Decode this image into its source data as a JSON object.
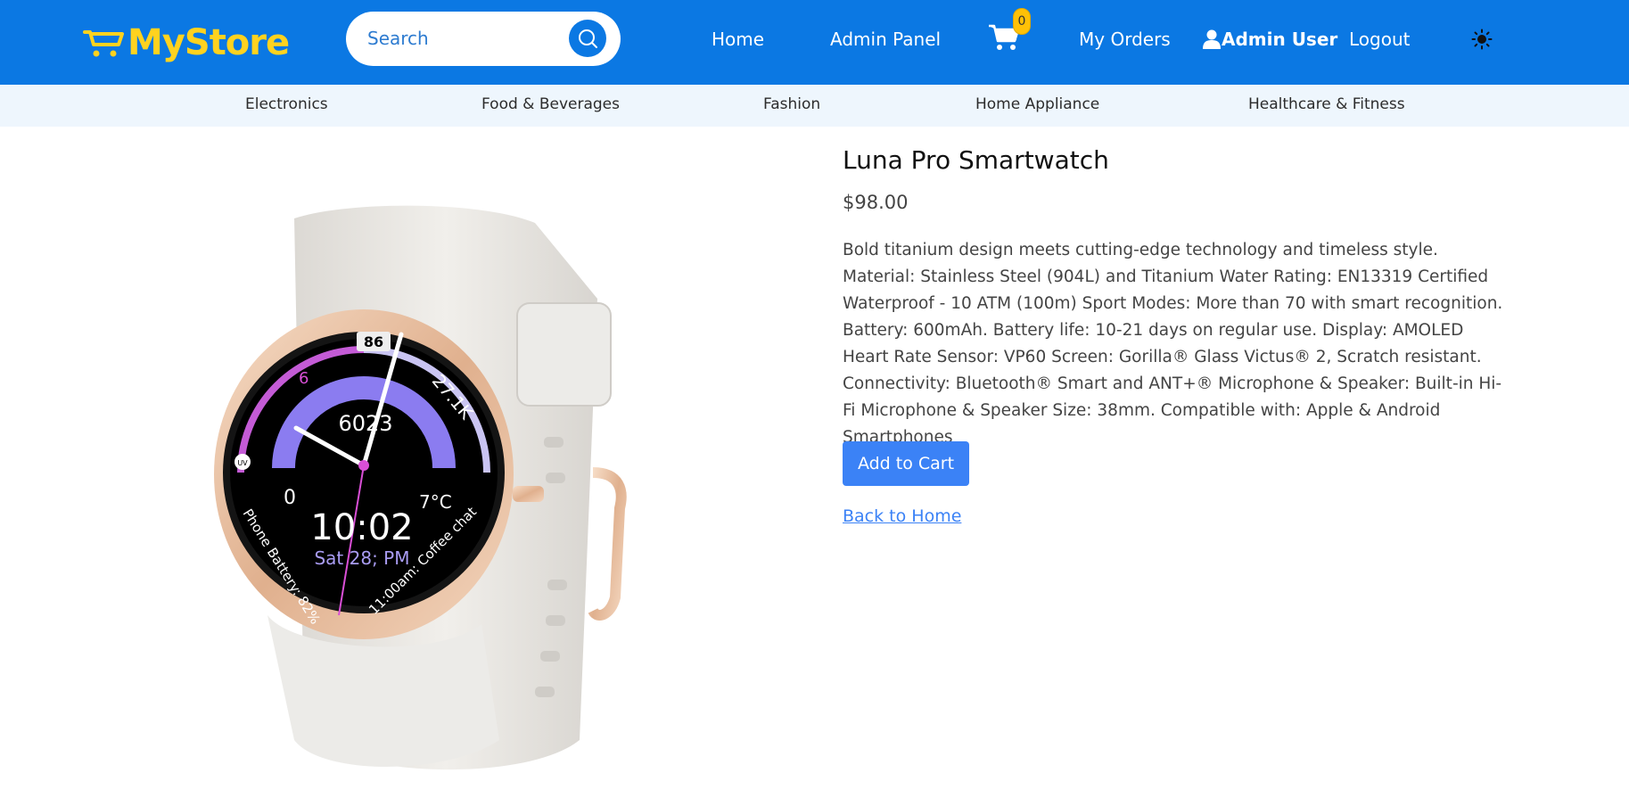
{
  "colors": {
    "navbar": "#0b78e3",
    "logo": "#ffd21f",
    "category_bar": "#eef6fd",
    "primary_button": "#3b82f6",
    "badge": "#ffc107"
  },
  "header": {
    "logo_text": "MyStore",
    "logo_icon": "cart-logo-icon",
    "search": {
      "placeholder": "Search",
      "value": "",
      "button_icon": "search-icon"
    },
    "nav": {
      "home": "Home",
      "admin_panel": "Admin Panel",
      "cart_icon": "cart-icon",
      "cart_count": "0",
      "my_orders": "My Orders",
      "user_icon": "user-icon",
      "user_name": "Admin User",
      "logout": "Logout",
      "theme_icon": "sun-icon"
    }
  },
  "categories": [
    "Electronics",
    "Food & Beverages",
    "Fashion",
    "Home Appliance",
    "Healthcare & Fitness"
  ],
  "product": {
    "name": "Luna Pro Smartwatch",
    "price": "$98.00",
    "description": "Bold titanium design meets cutting-edge technology and timeless style. Material: Stainless Steel (904L) and Titanium Water Rating: EN13319 Certified Waterproof - 10 ATM (100m) Sport Modes: More than 70 with smart recognition. Battery: 600mAh. Battery life: 10-21 days on regular use. Display: AMOLED Heart Rate Sensor: VP60 Screen: Gorilla® Glass Victus® 2, Scratch resistant. Connectivity: Bluetooth® Smart and ANT+® Microphone & Speaker: Built-in Hi-Fi Microphone & Speaker Size: 38mm. Compatible with: Apple & Android Smartphones",
    "add_to_cart": "Add to Cart",
    "back_link": "Back to Home",
    "watch_face": {
      "top_value": "86",
      "steps": "6023",
      "left_value": "6",
      "right_value": "27.1K",
      "temperature": "7°C",
      "zero": "0",
      "time": "10:02",
      "date": "Sat 28; PM",
      "battery": "Phone Battery: 82%",
      "event": "11:00am: Coffee chat",
      "uv": "UV"
    }
  }
}
